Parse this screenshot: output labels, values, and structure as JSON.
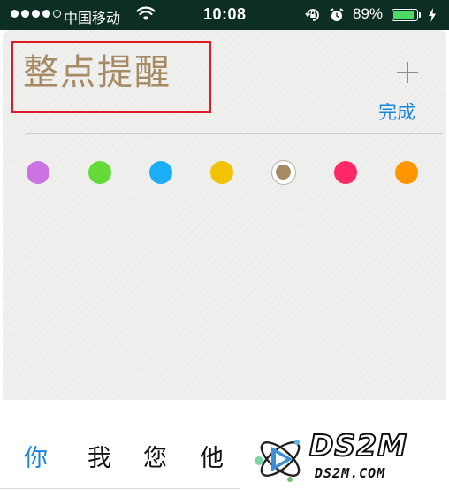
{
  "status_bar": {
    "carrier": "中国移动",
    "time": "10:08",
    "battery_percent": "89%",
    "battery_level": 0.89,
    "signal_bars": 4,
    "signal_total": 5,
    "icons": [
      "signal-dots",
      "wifi-icon",
      "rotation-lock-icon",
      "alarm-icon",
      "battery-icon",
      "charging-bolt-icon"
    ]
  },
  "list": {
    "title": "整点提醒",
    "done_label": "完成",
    "add_icon": "plus-icon",
    "title_highlight_color": "#e31a24",
    "colors": [
      {
        "name": "purple",
        "hex": "#cc73e1",
        "selected": false
      },
      {
        "name": "green",
        "hex": "#63da38",
        "selected": false
      },
      {
        "name": "blue",
        "hex": "#1badf8",
        "selected": false
      },
      {
        "name": "yellow",
        "hex": "#f2c204",
        "selected": false
      },
      {
        "name": "brown",
        "hex": "#a68a63",
        "selected": true
      },
      {
        "name": "red",
        "hex": "#ff2968",
        "selected": false
      },
      {
        "name": "orange",
        "hex": "#ff9500",
        "selected": false
      }
    ]
  },
  "keyboard": {
    "candidates": [
      {
        "text": "你",
        "active": true
      },
      {
        "text": "我",
        "active": false
      },
      {
        "text": "您",
        "active": false
      },
      {
        "text": "他",
        "active": false
      }
    ]
  },
  "watermark": {
    "title": "DS2M",
    "url": "DS2M.COM"
  }
}
